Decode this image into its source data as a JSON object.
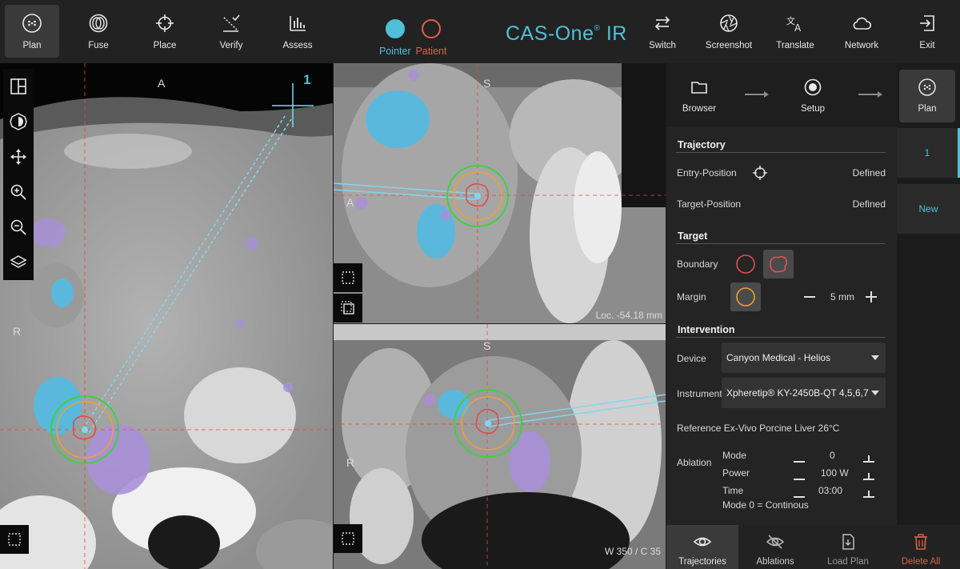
{
  "toolbar": {
    "left": [
      {
        "label": "Plan",
        "icon": "plan-icon"
      },
      {
        "label": "Fuse",
        "icon": "fuse-icon"
      },
      {
        "label": "Place",
        "icon": "place-crosshair-icon"
      },
      {
        "label": "Verify",
        "icon": "verify-icon"
      },
      {
        "label": "Assess",
        "icon": "assess-chart-icon"
      }
    ],
    "modes": {
      "pointer": "Pointer",
      "patient": "Patient"
    },
    "brand": "CAS-One",
    "brand_suffix": "IR",
    "brand_mark": "®",
    "right": [
      {
        "label": "Switch",
        "icon": "switch-arrows-icon"
      },
      {
        "label": "Screenshot",
        "icon": "camera-aperture-icon"
      },
      {
        "label": "Translate",
        "icon": "translate-icon"
      },
      {
        "label": "Network",
        "icon": "cloud-icon"
      },
      {
        "label": "Exit",
        "icon": "exit-icon"
      }
    ]
  },
  "viewports": {
    "axial": {
      "top": "A",
      "left": "R",
      "trajectory_number": "1"
    },
    "sagittal": {
      "top": "S",
      "left": "A",
      "location": "Loc. -54.18 mm"
    },
    "coronal": {
      "top": "S",
      "left": "R",
      "window": "W 350 / C 35"
    }
  },
  "steps": [
    {
      "label": "Browser",
      "icon": "folder-icon"
    },
    {
      "label": "Setup",
      "icon": "setup-radio-icon"
    },
    {
      "label": "Plan",
      "icon": "plan-icon"
    }
  ],
  "trajectory": {
    "title": "Trajectory",
    "entry_label": "Entry-Position",
    "entry_value": "Defined",
    "target_label": "Target-Position",
    "target_value": "Defined"
  },
  "target": {
    "title": "Target",
    "boundary_label": "Boundary",
    "margin_label": "Margin",
    "margin_value": "5 mm"
  },
  "intervention": {
    "title": "Intervention",
    "device_label": "Device",
    "device_value": "Canyon Medical - Helios",
    "instrument_label": "Instrument",
    "instrument_value": "Xpheretip® KY-2450B-QT 4,5,6,7",
    "reference": "Reference Ex-Vivo Porcine Liver 26°C",
    "ablation_label": "Ablation",
    "mode_label": "Mode",
    "mode_value": "0",
    "power_label": "Power",
    "power_value": "100 W",
    "time_label": "Time",
    "time_value": "03:00",
    "mode_note": "Mode 0 = Continous"
  },
  "trajectories_list": [
    {
      "label": "1"
    },
    {
      "label": "New"
    }
  ],
  "bottom": [
    {
      "label": "Trajectories",
      "icon": "eye-icon"
    },
    {
      "label": "Ablations",
      "icon": "eye-off-icon"
    },
    {
      "label": "Load Plan",
      "icon": "load-plan-icon"
    },
    {
      "label": "Delete All",
      "icon": "trash-icon"
    }
  ],
  "colors": {
    "accent": "#4fc0d8",
    "patient": "#e0604a",
    "danger": "#e0604a",
    "boundary": "#e04848",
    "margin": "#f0a030",
    "ablation_zone": "#40d040",
    "vessel": "#5ab8dc",
    "lesion": "#a890d8"
  }
}
